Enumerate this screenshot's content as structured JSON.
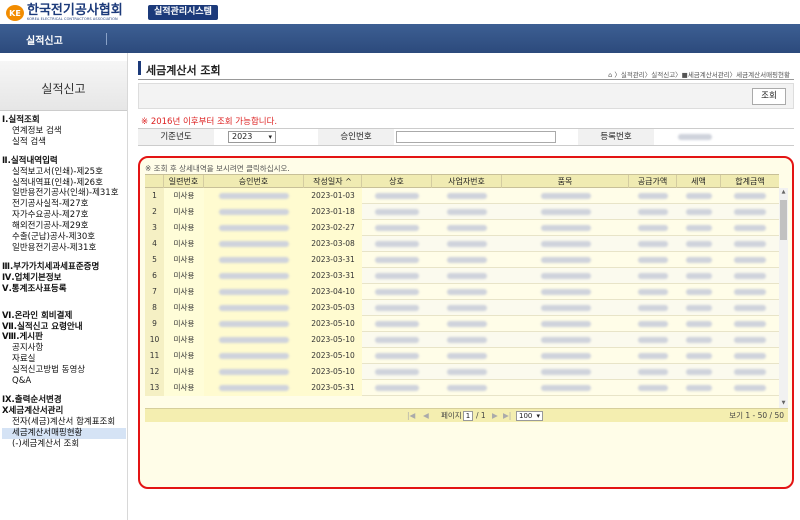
{
  "header": {
    "logo_text": "한국전기공사협회",
    "logo_en": "KOREA ELECTRICAL CONTRACTORS ASSOCIATION",
    "system_badge": "실적관리시스템",
    "nav_item": "실적신고"
  },
  "sidebar": {
    "title": "실적신고",
    "items": [
      {
        "label": "Ⅰ.실적조회",
        "type": "sec"
      },
      {
        "label": "연계정보 검색",
        "type": "sub"
      },
      {
        "label": "실적 검색",
        "type": "sub"
      },
      {
        "label": "",
        "type": "gap"
      },
      {
        "label": "Ⅱ.실적내역입력",
        "type": "sec"
      },
      {
        "label": "실적보고서(인쇄)-제25호",
        "type": "sub"
      },
      {
        "label": "실적내역표(인쇄)-제26호",
        "type": "sub"
      },
      {
        "label": "일반용전기공사(인쇄)-제31호",
        "type": "sub"
      },
      {
        "label": "전기공사실적-제27호",
        "type": "sub"
      },
      {
        "label": "자가수요공사-제27호",
        "type": "sub"
      },
      {
        "label": "해외전기공사-제29호",
        "type": "sub"
      },
      {
        "label": "수출(군납)공사-제30호",
        "type": "sub"
      },
      {
        "label": "일반용전기공사-제31호",
        "type": "sub"
      },
      {
        "label": "",
        "type": "gap"
      },
      {
        "label": "Ⅲ.부가가치세과세표준증명",
        "type": "sec"
      },
      {
        "label": "Ⅳ.업체기본정보",
        "type": "sec"
      },
      {
        "label": "Ⅴ.통계조사표등록",
        "type": "sec"
      },
      {
        "label": "",
        "type": "gap"
      },
      {
        "label": "",
        "type": "gap"
      },
      {
        "label": "Ⅵ.온라인 회비결제",
        "type": "sec"
      },
      {
        "label": "Ⅶ.실적신고 요령안내",
        "type": "sec"
      },
      {
        "label": "Ⅷ.게시판",
        "type": "sec"
      },
      {
        "label": "공지사항",
        "type": "sub"
      },
      {
        "label": "자료실",
        "type": "sub"
      },
      {
        "label": "실적신고방법 동영상",
        "type": "sub"
      },
      {
        "label": "Q&A",
        "type": "sub"
      },
      {
        "label": "",
        "type": "gap"
      },
      {
        "label": "Ⅸ.출력순서변경",
        "type": "sec"
      },
      {
        "label": "Ⅹ세금계산서관리",
        "type": "sec"
      },
      {
        "label": "전자(세금)계산서 합계표조회",
        "type": "sub"
      },
      {
        "label": "세금계산서매핑현황",
        "type": "sub",
        "active": true
      },
      {
        "label": "(-)세금계산서 조회",
        "type": "sub"
      }
    ]
  },
  "main": {
    "title": "세금계산서 조회",
    "breadcrumb": "⌂ 〉실적관리〉실적신고〉■세금계산서관리〉세금계산서매핑현황",
    "search_button": "조회",
    "notice": "※ 2016년 이후부터 조회 가능합니다.",
    "filters": {
      "year_label": "기준년도",
      "year_value": "2023",
      "approval_label": "승인번호",
      "reg_label": "등록번호"
    }
  },
  "grid": {
    "hint": "※ 조회 후 상세내역을 보시려면 클릭하십시오.",
    "columns": [
      "일련번호",
      "승인번호",
      "작성일자 ^",
      "상호",
      "사업자번호",
      "품목",
      "공급가액",
      "세액",
      "합계금액"
    ],
    "rows": [
      {
        "no": "1",
        "status": "미사용",
        "date": "2023-01-03"
      },
      {
        "no": "2",
        "status": "미사용",
        "date": "2023-01-18"
      },
      {
        "no": "3",
        "status": "미사용",
        "date": "2023-02-27"
      },
      {
        "no": "4",
        "status": "미사용",
        "date": "2023-03-08"
      },
      {
        "no": "5",
        "status": "미사용",
        "date": "2023-03-31"
      },
      {
        "no": "6",
        "status": "미사용",
        "date": "2023-03-31"
      },
      {
        "no": "7",
        "status": "미사용",
        "date": "2023-04-10"
      },
      {
        "no": "8",
        "status": "미사용",
        "date": "2023-05-03"
      },
      {
        "no": "9",
        "status": "미사용",
        "date": "2023-05-10"
      },
      {
        "no": "10",
        "status": "미사용",
        "date": "2023-05-10"
      },
      {
        "no": "11",
        "status": "미사용",
        "date": "2023-05-10"
      },
      {
        "no": "12",
        "status": "미사용",
        "date": "2023-05-10"
      },
      {
        "no": "13",
        "status": "미사용",
        "date": "2023-05-31"
      }
    ],
    "pager": {
      "page_label": "페이지",
      "page_value": "1",
      "total_pages": "/ 1",
      "page_size": "100",
      "summary": "보기 1 - 50 / 50"
    }
  }
}
